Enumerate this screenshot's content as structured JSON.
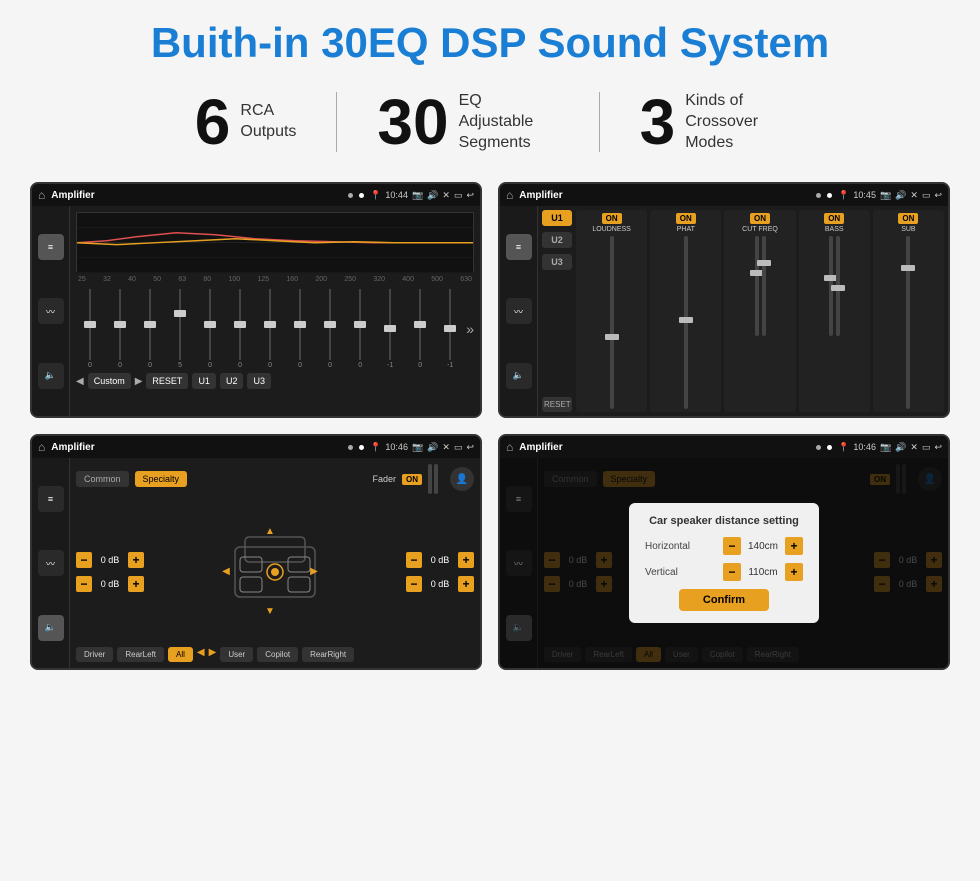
{
  "title": "Buith-in 30EQ DSP Sound System",
  "stats": [
    {
      "number": "6",
      "label_line1": "RCA",
      "label_line2": "Outputs"
    },
    {
      "number": "30",
      "label_line1": "EQ Adjustable",
      "label_line2": "Segments"
    },
    {
      "number": "3",
      "label_line1": "Kinds of",
      "label_line2": "Crossover Modes"
    }
  ],
  "screens": {
    "eq": {
      "app_title": "Amplifier",
      "time": "10:44",
      "freq_labels": [
        "25",
        "32",
        "40",
        "50",
        "63",
        "80",
        "100",
        "125",
        "160",
        "200",
        "250",
        "320",
        "400",
        "500",
        "630"
      ],
      "sliders": [
        {
          "pos": 50,
          "val": "0"
        },
        {
          "pos": 50,
          "val": "0"
        },
        {
          "pos": 50,
          "val": "0"
        },
        {
          "pos": 42,
          "val": "5"
        },
        {
          "pos": 50,
          "val": "0"
        },
        {
          "pos": 50,
          "val": "0"
        },
        {
          "pos": 50,
          "val": "0"
        },
        {
          "pos": 50,
          "val": "0"
        },
        {
          "pos": 50,
          "val": "0"
        },
        {
          "pos": 50,
          "val": "0"
        },
        {
          "pos": 54,
          "val": "-1"
        },
        {
          "pos": 50,
          "val": "0"
        },
        {
          "pos": 54,
          "val": "-1"
        }
      ],
      "preset": "Custom",
      "buttons": [
        "RESET",
        "U1",
        "U2",
        "U3"
      ]
    },
    "crossover": {
      "app_title": "Amplifier",
      "time": "10:45",
      "u_buttons": [
        "U1",
        "U2",
        "U3"
      ],
      "channels": [
        {
          "label": "LOUDNESS",
          "on": true
        },
        {
          "label": "PHAT",
          "on": true
        },
        {
          "label": "CUT FREQ",
          "on": true
        },
        {
          "label": "BASS",
          "on": true
        },
        {
          "label": "SUB",
          "on": true
        }
      ]
    },
    "fader": {
      "app_title": "Amplifier",
      "time": "10:46",
      "modes": [
        "Common",
        "Specialty"
      ],
      "fader_label": "Fader",
      "on_label": "ON",
      "db_controls": [
        {
          "val": "0 dB"
        },
        {
          "val": "0 dB"
        },
        {
          "val": "0 dB"
        },
        {
          "val": "0 dB"
        }
      ],
      "nav_btns": [
        "Driver",
        "RearLeft",
        "All",
        "User",
        "Copilot",
        "RearRight"
      ]
    },
    "fader_dialog": {
      "app_title": "Amplifier",
      "time": "10:46",
      "modes": [
        "Common",
        "Specialty"
      ],
      "on_label": "ON",
      "dialog": {
        "title": "Car speaker distance setting",
        "horizontal_label": "Horizontal",
        "horizontal_val": "140cm",
        "vertical_label": "Vertical",
        "vertical_val": "110cm",
        "confirm_label": "Confirm"
      },
      "db_controls_right": [
        {
          "val": "0 dB"
        },
        {
          "val": "0 dB"
        }
      ],
      "nav_btns": [
        "Driver",
        "RearLeft",
        "All",
        "User",
        "Copilot",
        "RearRight"
      ]
    }
  }
}
